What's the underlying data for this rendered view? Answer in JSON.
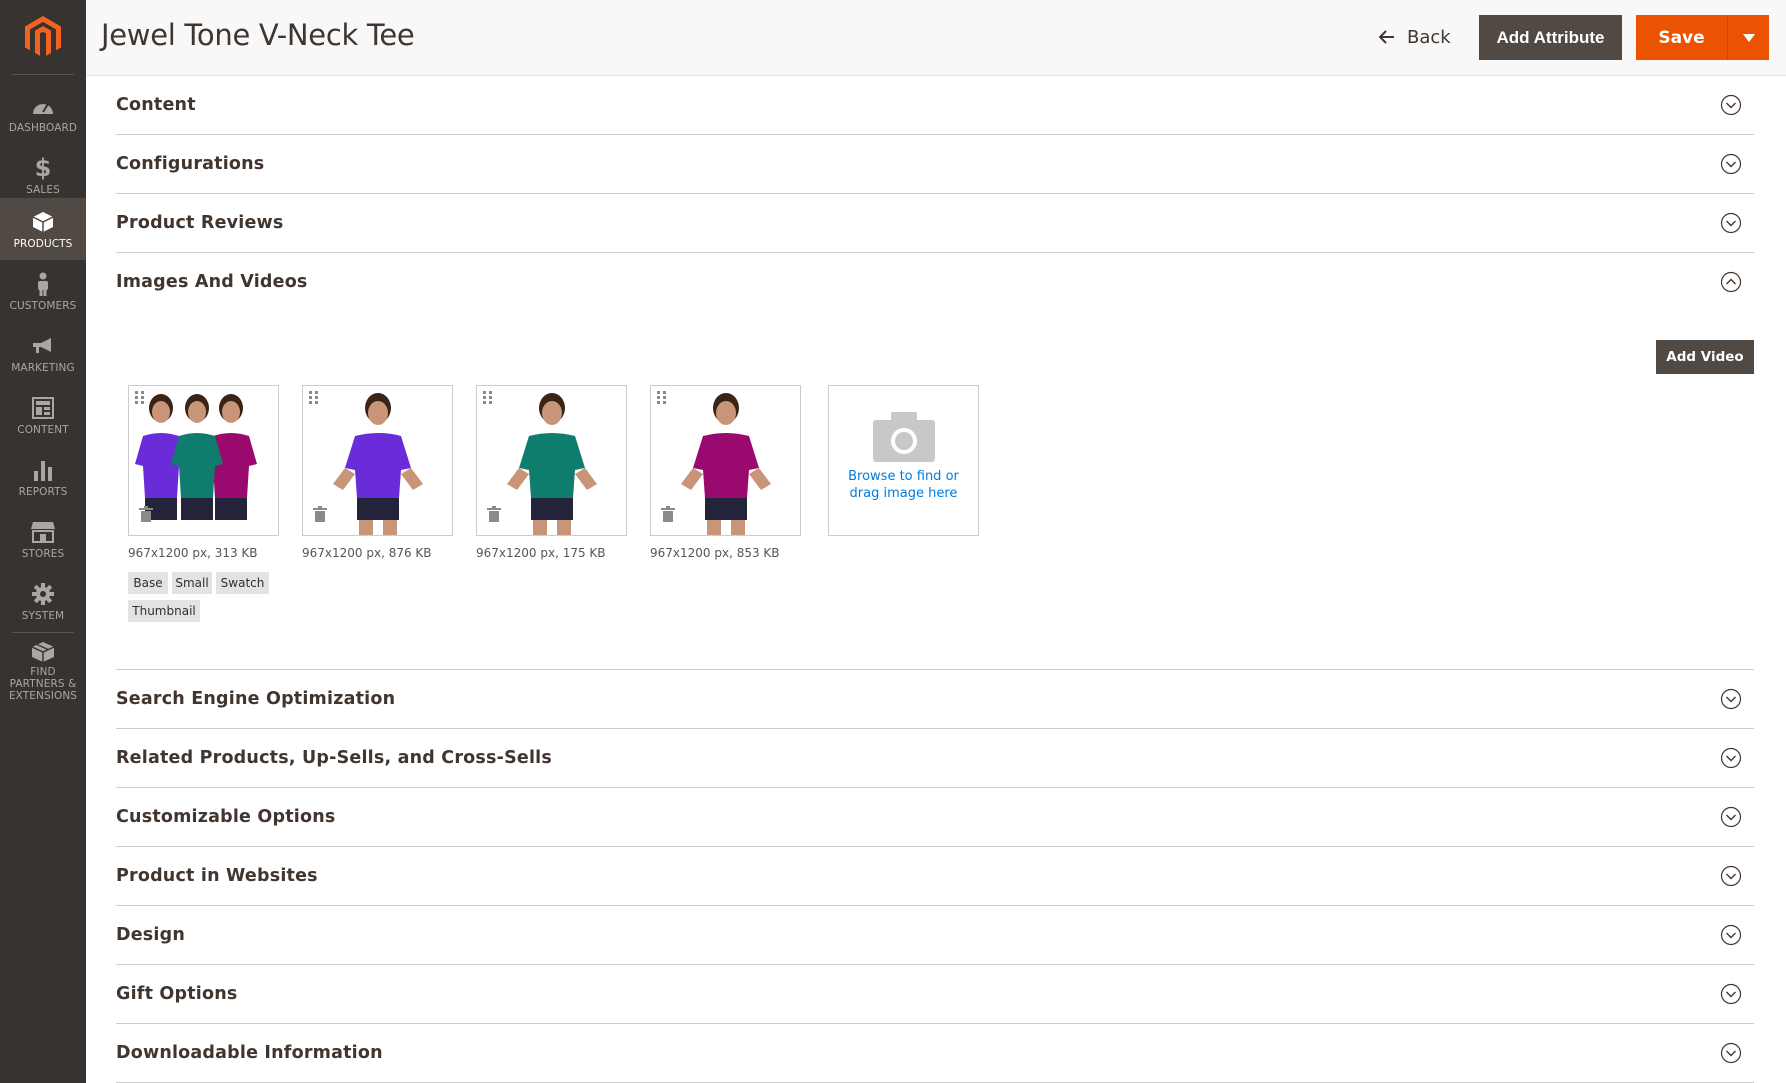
{
  "sidebar": {
    "items": [
      {
        "label": "Dashboard",
        "icon": "dashboard-icon"
      },
      {
        "label": "Sales",
        "icon": "dollar-icon"
      },
      {
        "label": "Products",
        "icon": "cube-icon",
        "active": true
      },
      {
        "label": "Customers",
        "icon": "person-icon"
      },
      {
        "label": "Marketing",
        "icon": "megaphone-icon"
      },
      {
        "label": "Content",
        "icon": "layout-icon"
      },
      {
        "label": "Reports",
        "icon": "bar-chart-icon"
      },
      {
        "label": "Stores",
        "icon": "storefront-icon"
      },
      {
        "label": "System",
        "icon": "gear-icon"
      },
      {
        "label": "Find Partners & Extensions",
        "icon": "box-icon"
      }
    ]
  },
  "header": {
    "title": "Jewel Tone V-Neck Tee",
    "back_label": "Back",
    "add_attribute_label": "Add Attribute",
    "save_label": "Save"
  },
  "sections": {
    "content": "Content",
    "configurations": "Configurations",
    "product_reviews": "Product Reviews",
    "images_and_videos": "Images And Videos",
    "seo": "Search Engine Optimization",
    "related": "Related Products, Up-Sells, and Cross-Sells",
    "customizable": "Customizable Options",
    "websites": "Product in Websites",
    "design": "Design",
    "gift": "Gift Options",
    "downloadable": "Downloadable Information"
  },
  "images": {
    "add_video_label": "Add Video",
    "items": [
      {
        "meta": "967x1200 px, 313 KB"
      },
      {
        "meta": "967x1200 px, 876 KB"
      },
      {
        "meta": "967x1200 px, 175 KB"
      },
      {
        "meta": "967x1200 px, 853 KB"
      }
    ],
    "roles": [
      "Base",
      "Small",
      "Swatch",
      "Thumbnail"
    ],
    "browse_line1": "Browse to find or",
    "browse_line2": "drag image here"
  },
  "colors": {
    "sidebar_bg": "#373330",
    "accent": "#eb5202",
    "dark_button": "#514943",
    "link": "#007bdb",
    "shirt_purple": "#6a2bd8",
    "shirt_teal": "#0f7d6e",
    "shirt_magenta": "#9a0a6e"
  }
}
